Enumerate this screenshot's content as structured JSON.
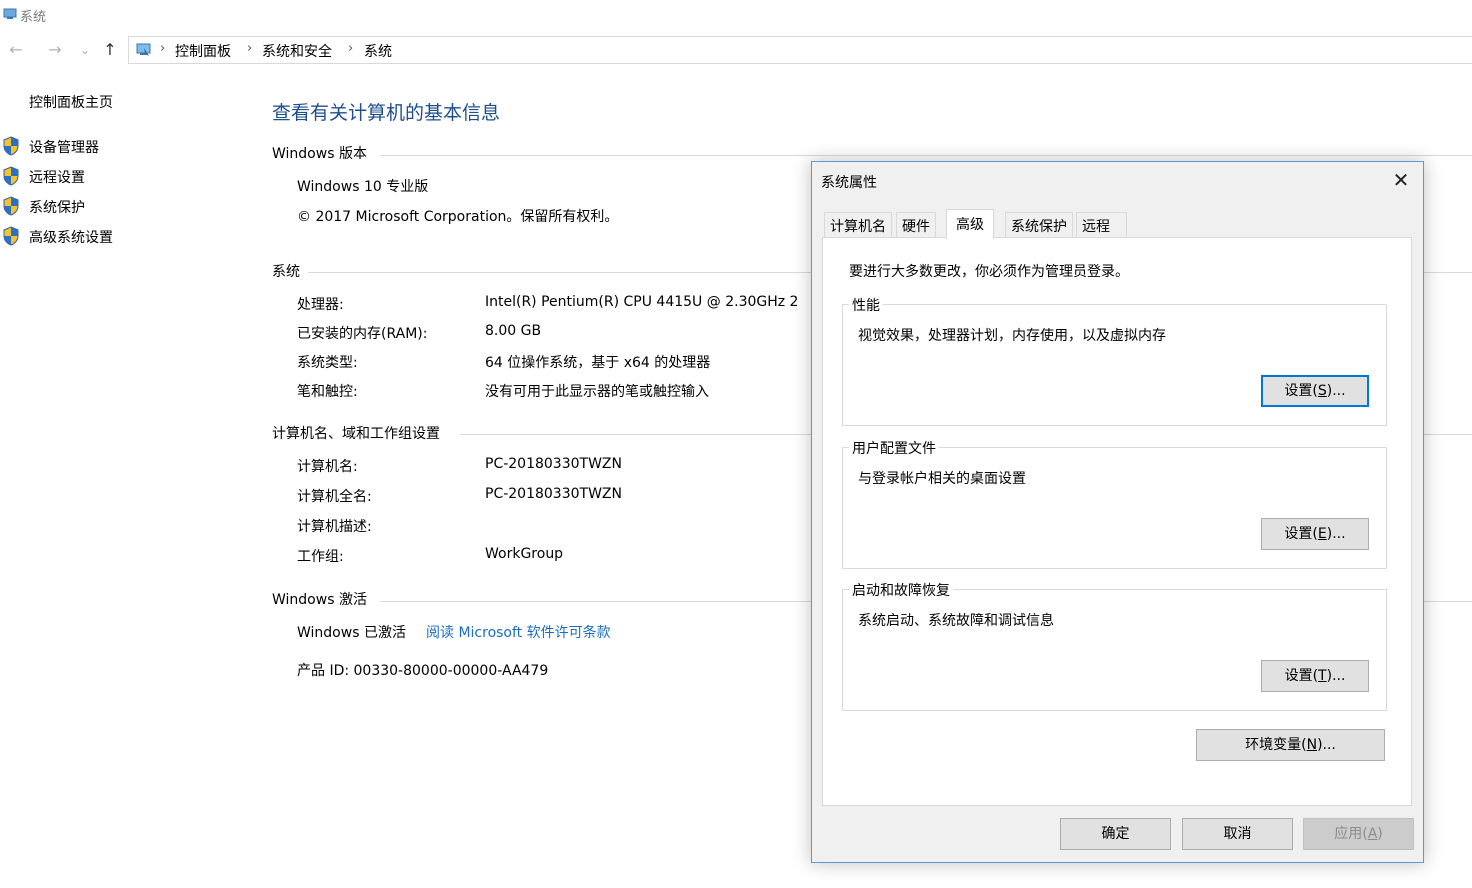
{
  "window": {
    "title": "系统"
  },
  "nav": {
    "back": "←",
    "forward": "→",
    "recent": "⌄",
    "up": "↑",
    "breadcrumb": [
      "控制面板",
      "系统和安全",
      "系统"
    ]
  },
  "sidebar": {
    "home": "控制面板主页",
    "items": [
      {
        "label": "设备管理器"
      },
      {
        "label": "远程设置"
      },
      {
        "label": "系统保护"
      },
      {
        "label": "高级系统设置"
      }
    ]
  },
  "main": {
    "title": "查看有关计算机的基本信息",
    "windows_edition": {
      "heading": "Windows 版本",
      "edition": "Windows 10 专业版",
      "copyright": "© 2017 Microsoft Corporation。保留所有权利。"
    },
    "system": {
      "heading": "系统",
      "rows": [
        {
          "label": "处理器:",
          "value": "Intel(R) Pentium(R) CPU 4415U @ 2.30GHz   2"
        },
        {
          "label": "已安装的内存(RAM):",
          "value": "8.00 GB"
        },
        {
          "label": "系统类型:",
          "value": "64 位操作系统，基于 x64 的处理器"
        },
        {
          "label": "笔和触控:",
          "value": "没有可用于此显示器的笔或触控输入"
        }
      ]
    },
    "computer_name": {
      "heading": "计算机名、域和工作组设置",
      "rows": [
        {
          "label": "计算机名:",
          "value": "PC-20180330TWZN"
        },
        {
          "label": "计算机全名:",
          "value": "PC-20180330TWZN"
        },
        {
          "label": "计算机描述:",
          "value": ""
        },
        {
          "label": "工作组:",
          "value": "WorkGroup"
        }
      ]
    },
    "activation": {
      "heading": "Windows 激活",
      "status": "Windows 已激活",
      "license_link": "阅读 Microsoft 软件许可条款",
      "product_id": "产品 ID: 00330-80000-00000-AA479"
    }
  },
  "dialog": {
    "title": "系统属性",
    "close": "✕",
    "tabs": [
      {
        "label": "计算机名"
      },
      {
        "label": "硬件"
      },
      {
        "label": "高级",
        "active": true
      },
      {
        "label": "系统保护"
      },
      {
        "label": "远程"
      }
    ],
    "admin_note": "要进行大多数更改，你必须作为管理员登录。",
    "groups": [
      {
        "title": "性能",
        "desc": "视觉效果，处理器计划，内存使用，以及虚拟内存",
        "button_pre": "设置(",
        "button_key": "S",
        "button_post": ")..."
      },
      {
        "title": "用户配置文件",
        "desc": "与登录帐户相关的桌面设置",
        "button_pre": "设置(",
        "button_key": "E",
        "button_post": ")..."
      },
      {
        "title": "启动和故障恢复",
        "desc": "系统启动、系统故障和调试信息",
        "button_pre": "设置(",
        "button_key": "T",
        "button_post": ")..."
      }
    ],
    "env_button": {
      "pre": "环境变量(",
      "key": "N",
      "post": ")..."
    },
    "ok": "确定",
    "cancel": "取消",
    "apply": {
      "pre": "应用(",
      "key": "A",
      "post": ")"
    }
  }
}
